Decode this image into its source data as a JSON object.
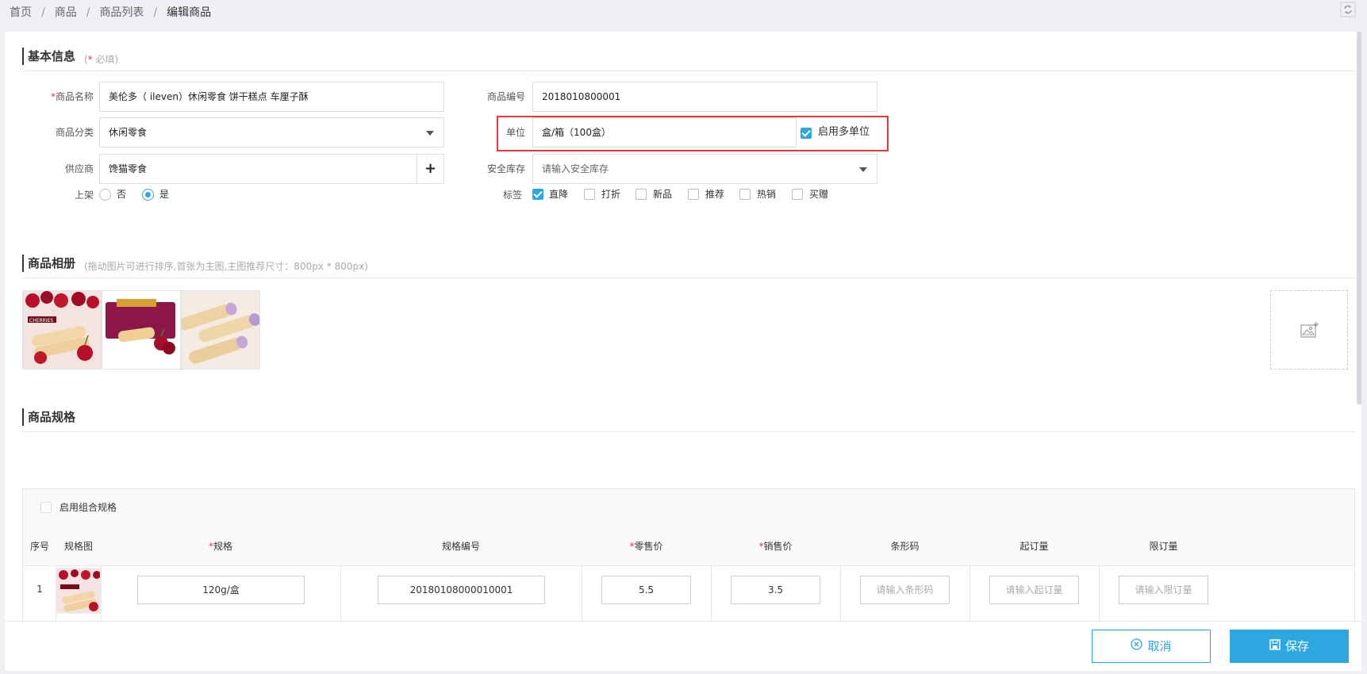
{
  "breadcrumb": [
    "首页",
    "商品",
    "商品列表",
    "编辑商品"
  ],
  "breadcrumb_sep": "/",
  "basic": {
    "title": "基本信息",
    "hint_prefix": "(",
    "hint_star": "*",
    "hint_text": " 必填)",
    "name_label": "商品名称",
    "name_value": "美伦多（ ileven）休闲零食 饼干糕点 车厘子酥",
    "code_label": "商品编号",
    "code_value": "2018010800001",
    "category_label": "商品分类",
    "category_value": "休闲零食",
    "unit_label": "单位",
    "unit_value": "盒/箱（100盒）",
    "multi_unit_label": "启用多单位",
    "multi_unit_checked": true,
    "supplier_label": "供应商",
    "supplier_value": "馋猫零食",
    "supplier_add": "+",
    "stock_label": "安全库存",
    "stock_placeholder": "请输入安全库存",
    "shelf_label": "上架",
    "shelf_options": [
      "否",
      "是"
    ],
    "shelf_selected": "是",
    "tags_label": "标签",
    "tags": [
      {
        "label": "直降",
        "checked": true
      },
      {
        "label": "打折",
        "checked": false
      },
      {
        "label": "新品",
        "checked": false
      },
      {
        "label": "推荐",
        "checked": false
      },
      {
        "label": "热销",
        "checked": false
      },
      {
        "label": "买赠",
        "checked": false
      }
    ]
  },
  "album": {
    "title": "商品相册",
    "hint": "(拖动图片可进行排序,首张为主图,主图推荐尺寸：800px * 800px)",
    "badge": "CHERRIES"
  },
  "spec": {
    "title": "商品规格",
    "combo_label": "启用组合规格",
    "columns": {
      "index": "序号",
      "image": "规格图",
      "spec": "规格",
      "spec_code": "规格编号",
      "retail_price": "零售价",
      "sale_price": "销售价",
      "barcode": "条形码",
      "min_order": "起订量",
      "max_order": "限订量"
    },
    "required_mark": "*",
    "rows": [
      {
        "index": "1",
        "spec": "120g/盒",
        "spec_code": "20180108000010001",
        "retail_price": "5.5",
        "sale_price": "3.5",
        "barcode_placeholder": "请输入条形码",
        "min_order_placeholder": "请输入起订量",
        "max_order_placeholder": "请输入限订量"
      }
    ]
  },
  "actions": {
    "cancel": "取消",
    "save": "保存"
  },
  "colors": {
    "accent": "#2da7e0",
    "required": "#e4393c",
    "highlight": "#e4393c"
  }
}
